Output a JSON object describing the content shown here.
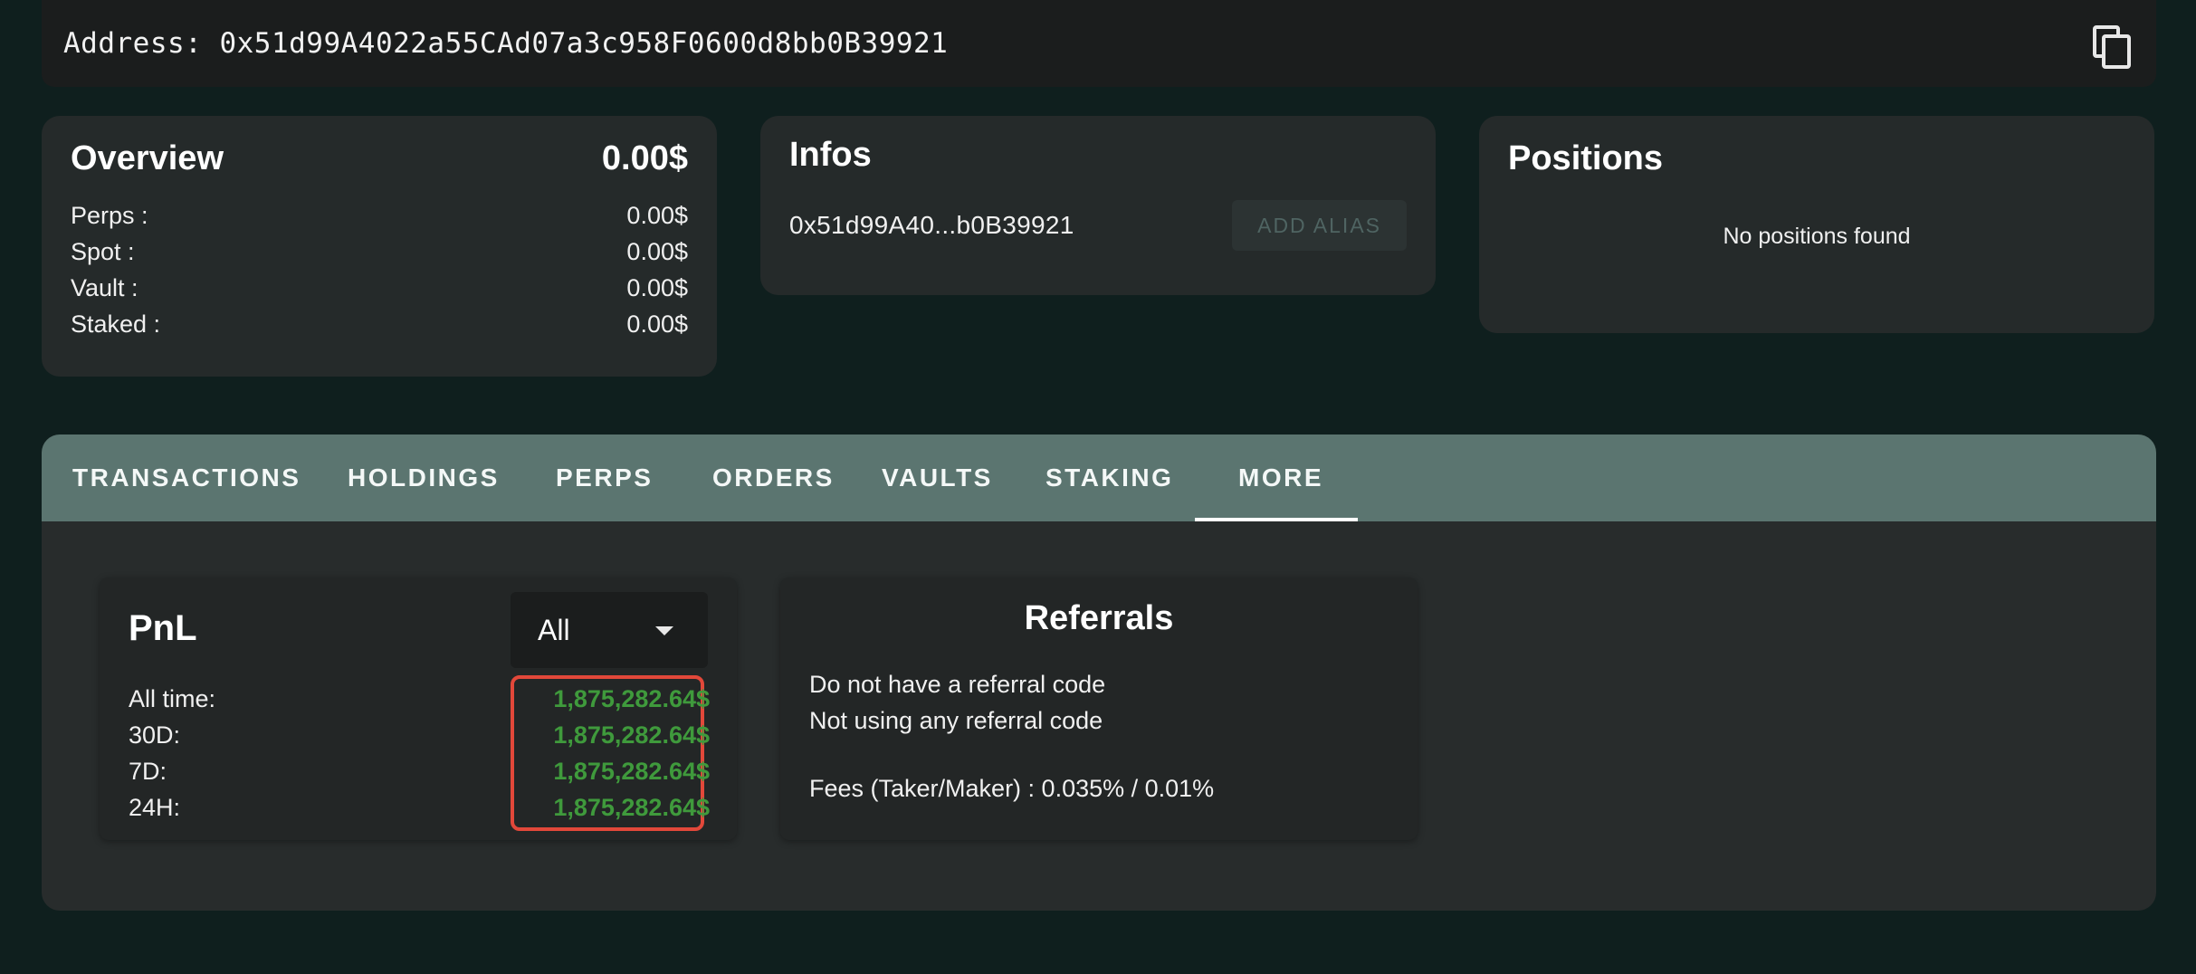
{
  "address_bar": {
    "label": "Address: 0x51d99A4022a55CAd07a3c958F0600d8bb0B39921",
    "copy_icon": "copy-icon"
  },
  "overview": {
    "title": "Overview",
    "total": "0.00$",
    "rows": [
      {
        "label": "Perps :",
        "value": "0.00$"
      },
      {
        "label": "Spot :",
        "value": "0.00$"
      },
      {
        "label": "Vault :",
        "value": "0.00$"
      },
      {
        "label": "Staked :",
        "value": "0.00$"
      }
    ]
  },
  "infos": {
    "title": "Infos",
    "short_address": "0x51d99A40...b0B39921",
    "add_alias_label": "ADD ALIAS"
  },
  "positions": {
    "title": "Positions",
    "empty_text": "No positions found"
  },
  "tabs": [
    {
      "label": "TRANSACTIONS"
    },
    {
      "label": "HOLDINGS"
    },
    {
      "label": "PERPS"
    },
    {
      "label": "ORDERS"
    },
    {
      "label": "VAULTS"
    },
    {
      "label": "STAKING"
    },
    {
      "label": "MORE",
      "active": true
    }
  ],
  "pnl": {
    "title": "PnL",
    "selected_range": "All",
    "rows": [
      {
        "label": "All time:",
        "value": "1,875,282.64$"
      },
      {
        "label": "30D:",
        "value": "1,875,282.64$"
      },
      {
        "label": "7D:",
        "value": "1,875,282.64$"
      },
      {
        "label": "24H:",
        "value": "1,875,282.64$"
      }
    ]
  },
  "referrals": {
    "title": "Referrals",
    "lines": [
      "Do not have a referral code",
      "Not using any referral code"
    ],
    "fees": "Fees (Taker/Maker) : 0.035% / 0.01%"
  },
  "colors": {
    "background": "#0f1f1e",
    "card": "#252a2a",
    "tabbar": "#5b7570",
    "pnl_positive": "#3f9a3c",
    "highlight_border": "#e2483a"
  }
}
